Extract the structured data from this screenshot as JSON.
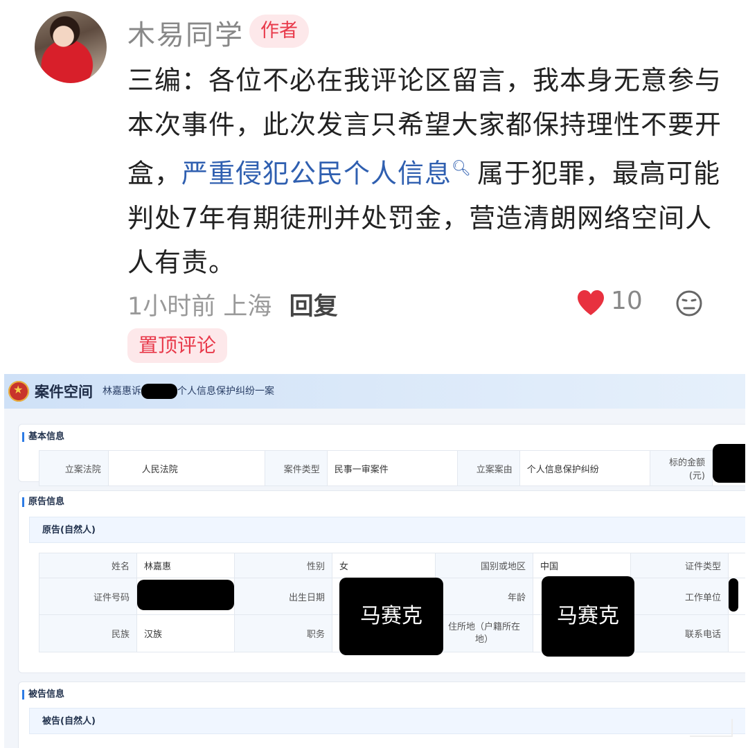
{
  "comment": {
    "author": "木易同学",
    "badge": "作者",
    "text_before": "三编：各位不必在我评论区留言，我本身无意参与本次事件，此次发言只希望大家都保持理性不要开盒，",
    "link_text": "严重侵犯公民个人信息",
    "text_after": "属于犯罪，最高可能判处7年有期徒刑并处罚金，营造清朗网络空间人人有责。",
    "time": "1小时前",
    "location": "上海",
    "reply_label": "回复",
    "like_count": "10",
    "pinned_label": "置顶评论",
    "icons": [
      "heart-icon",
      "search-icon",
      "emoji-icon"
    ]
  },
  "court": {
    "app_title": "案件空间",
    "case_title_prefix": "林嘉惠诉",
    "case_title_suffix": "个人信息保护纠纷一案",
    "redaction_watermark": "马赛克",
    "basic": {
      "section_title": "基本信息",
      "court_label": "立案法院",
      "court_value": "人民法院",
      "type_label": "案件类型",
      "type_value": "民事一审案件",
      "cause_label": "立案案由",
      "cause_value": "个人信息保护纠纷",
      "amount_label": "标的金额(元)"
    },
    "plaintiff": {
      "section_title": "原告信息",
      "subheader": "原告(自然人)",
      "rows": [
        [
          "姓名",
          "林嘉惠",
          "性别",
          "女",
          "国别或地区",
          "中国",
          "证件类型"
        ],
        [
          "证件号码",
          "",
          "出生日期",
          "",
          "年龄",
          "",
          "工作单位"
        ],
        [
          "民族",
          "汉族",
          "职务",
          "",
          "住所地（户籍所在地）",
          "",
          "联系电话"
        ]
      ]
    },
    "defendant": {
      "section_title": "被告信息",
      "subheader": "被告(自然人)"
    },
    "colors": {
      "link": "#2f5fb0",
      "badge": "#e8394a",
      "heart": "#e8313f",
      "header": "#cfe1f7"
    }
  }
}
